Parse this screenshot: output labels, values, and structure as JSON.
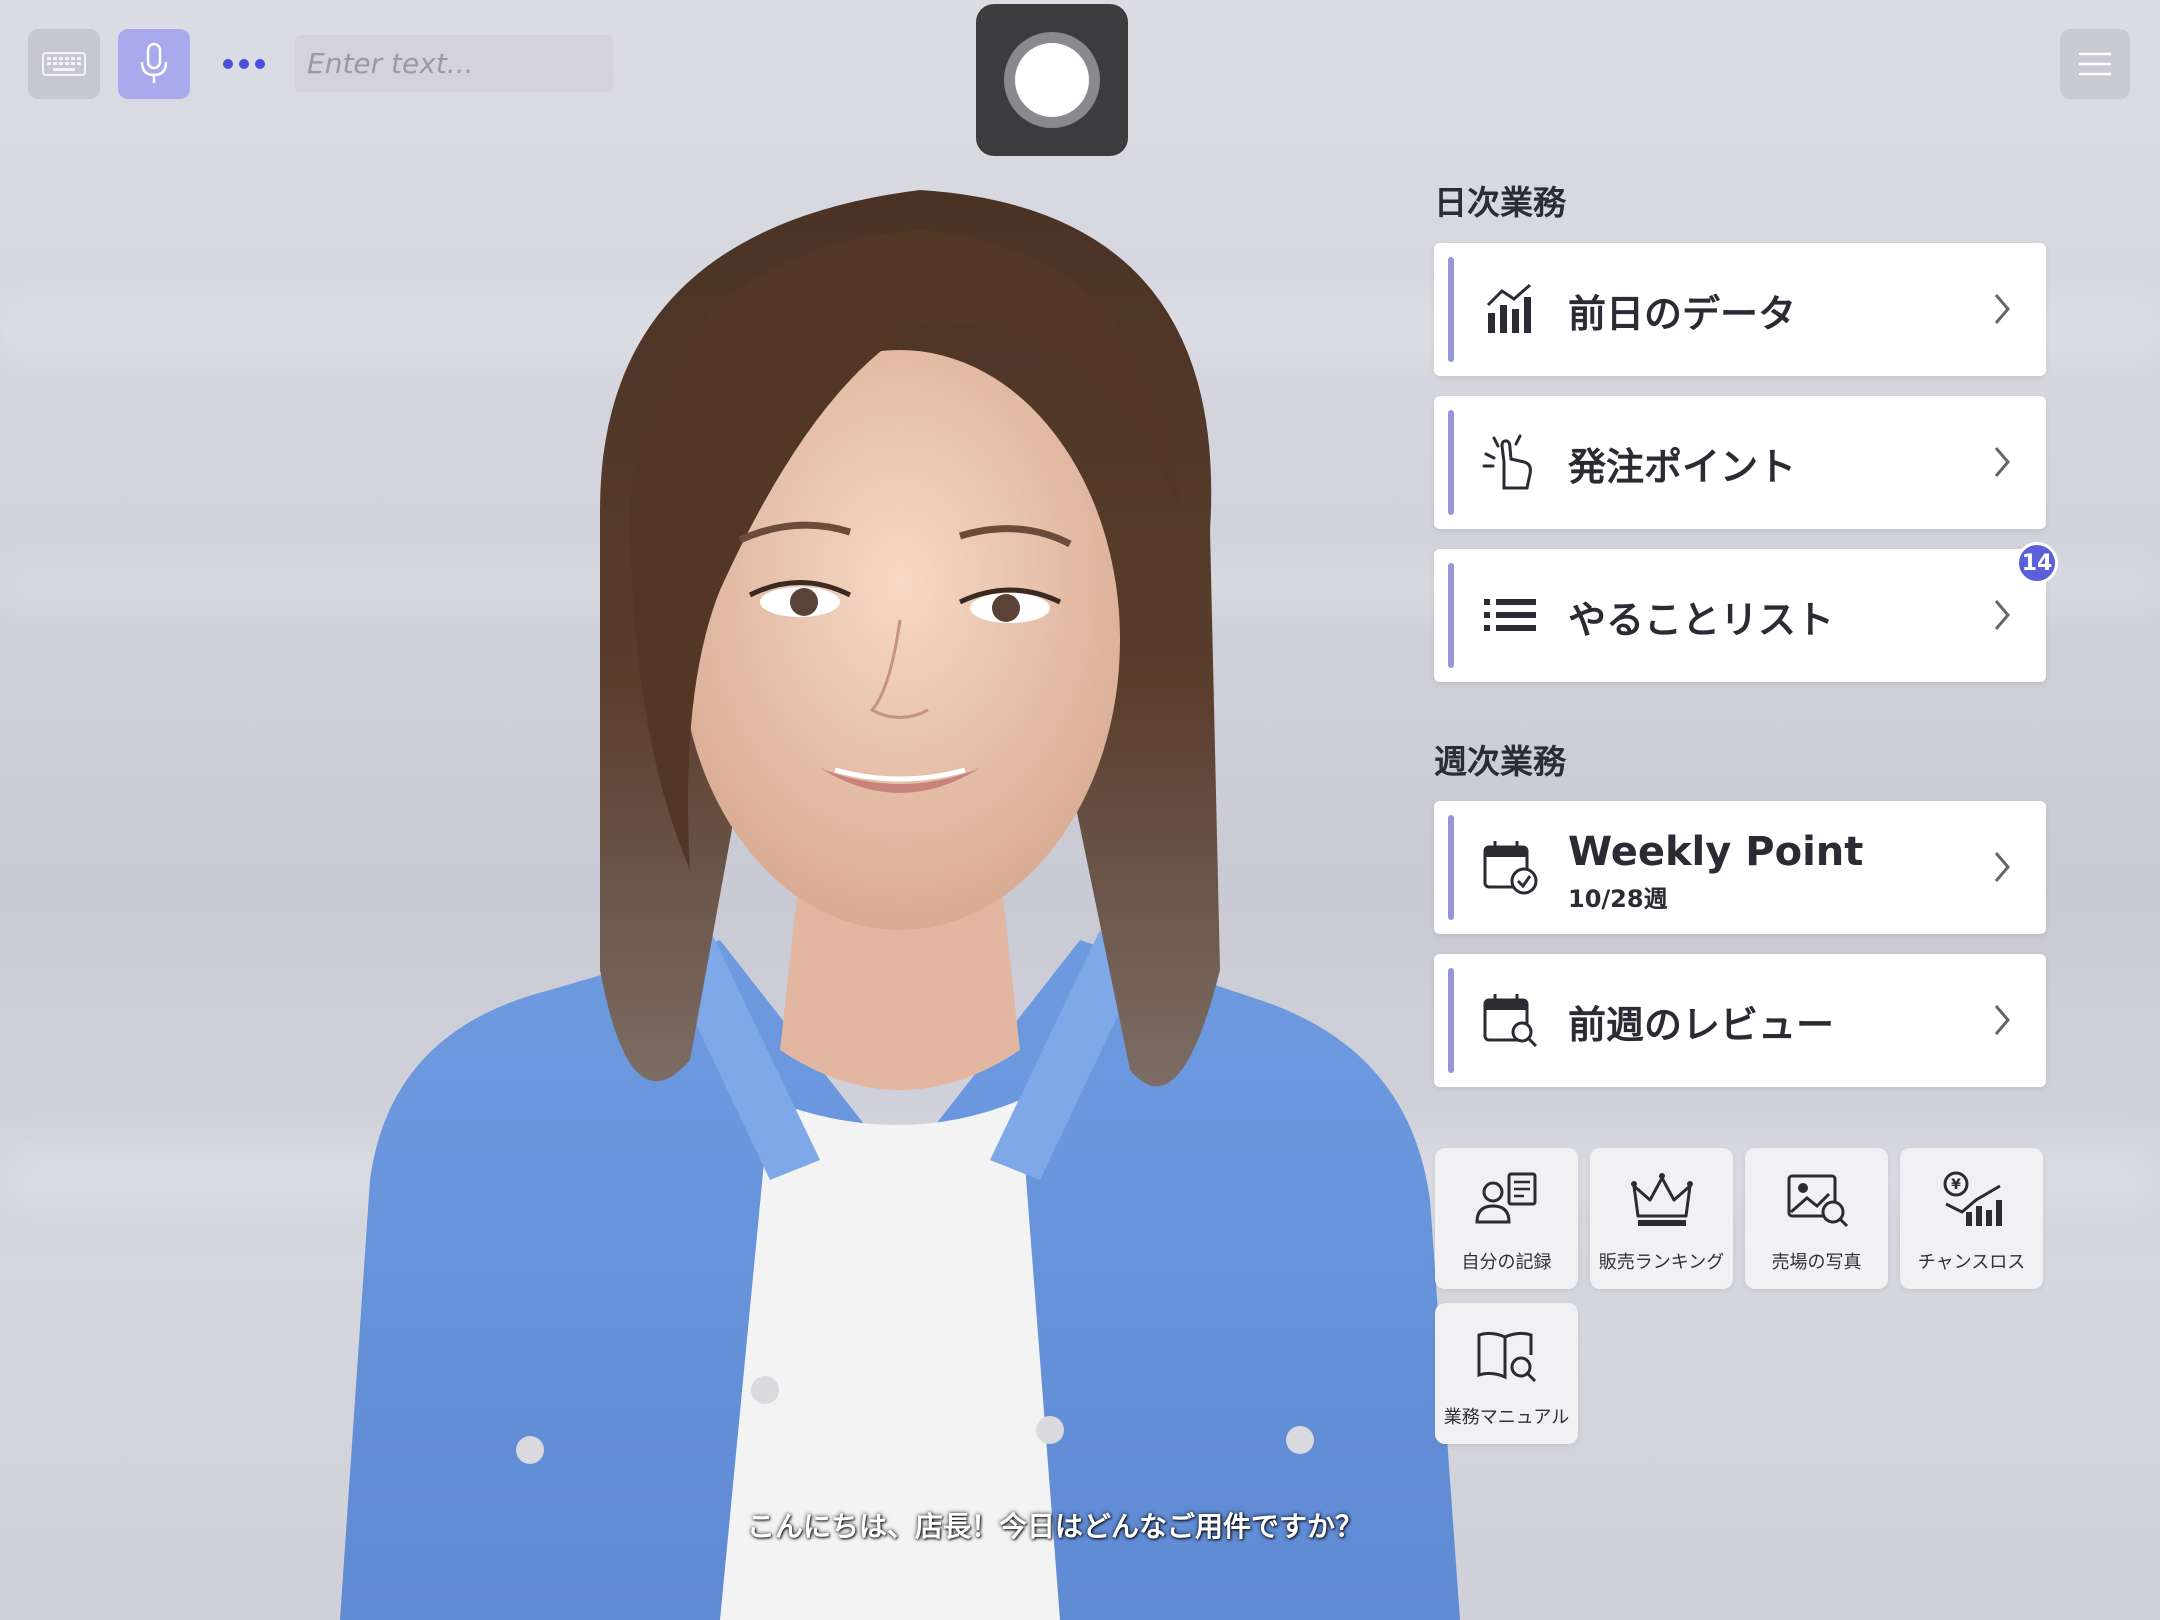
{
  "topbar": {
    "keyboard_icon": "keyboard-icon",
    "mic_icon": "microphone-icon",
    "more_icon": "ellipsis-icon",
    "input_placeholder": "Enter text...",
    "record_icon": "record-icon",
    "menu_icon": "hamburger-menu-icon"
  },
  "daily": {
    "title": "日次業務",
    "items": [
      {
        "label": "前日のデータ",
        "icon": "bar-chart-icon"
      },
      {
        "label": "発注ポイント",
        "icon": "pointing-hand-icon"
      },
      {
        "label": "やることリスト",
        "icon": "list-icon",
        "badge": "14"
      }
    ]
  },
  "weekly": {
    "title": "週次業務",
    "items": [
      {
        "label": "Weekly Point",
        "sub": "10/28週",
        "icon": "calendar-check-icon"
      },
      {
        "label": "前週のレビュー",
        "icon": "calendar-search-icon"
      }
    ]
  },
  "tiles": [
    {
      "label": "自分の記録",
      "icon": "person-record-icon"
    },
    {
      "label": "販売ランキング",
      "icon": "crown-icon"
    },
    {
      "label": "売場の写真",
      "icon": "photo-search-icon"
    },
    {
      "label": "チャンスロス",
      "icon": "yen-chart-icon"
    },
    {
      "label": "業務マニュアル",
      "icon": "book-search-icon"
    }
  ],
  "caption": "こんにちは、店長！今日はどんなご用件ですか？",
  "colors": {
    "accent": "#9597d6",
    "badge": "#5b5fd9",
    "mic_active": "#a9aaee"
  }
}
